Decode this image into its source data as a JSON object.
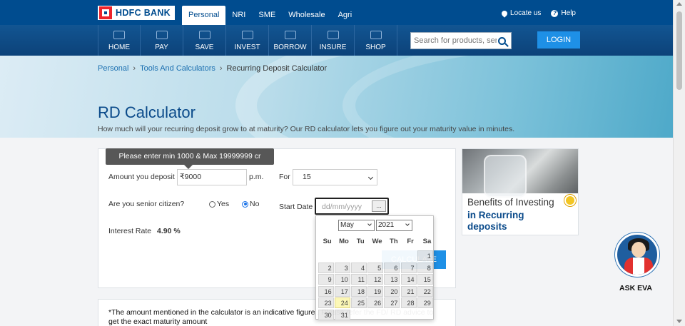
{
  "header": {
    "logo_text": "HDFC BANK",
    "segments": [
      "Personal",
      "NRI",
      "SME",
      "Wholesale",
      "Agri"
    ],
    "active_segment": "Personal",
    "locate_us": "Locate us",
    "help": "Help"
  },
  "nav": {
    "items": [
      "HOME",
      "PAY",
      "SAVE",
      "INVEST",
      "BORROW",
      "INSURE",
      "SHOP"
    ],
    "search_placeholder": "Search for products, services",
    "login_label": "LOGIN"
  },
  "breadcrumb": {
    "items": [
      "Personal",
      "Tools And Calculators",
      "Recurring Deposit Calculator"
    ]
  },
  "hero": {
    "title": "RD Calculator",
    "subtitle": "How much will your recurring deposit grow to at maturity? Our RD calculator lets you figure out your maturity value in minutes."
  },
  "calculator": {
    "tooltip": "Please enter min 1000 & Max 19999999 cr",
    "amount_label": "Amount you deposit",
    "amount_value": "₹9000",
    "per_label": "p.m.",
    "for_label": "For",
    "for_value": "15",
    "senior_label": "Are you senior citizen?",
    "yes_label": "Yes",
    "no_label": "No",
    "start_date_label": "Start Date",
    "start_date_placeholder": "dd/mm/yyyy",
    "date_button": "...",
    "rate_label": "Interest Rate",
    "rate_value": "4.90 %",
    "calculate_label": "CALCULATE"
  },
  "datepicker": {
    "month": "May",
    "year": "2021",
    "weekdays": [
      "Su",
      "Mo",
      "Tu",
      "We",
      "Th",
      "Fr",
      "Sa"
    ],
    "weeks": [
      [
        "",
        "",
        "",
        "",
        "",
        "",
        "1"
      ],
      [
        "2",
        "3",
        "4",
        "5",
        "6",
        "7",
        "8"
      ],
      [
        "9",
        "10",
        "11",
        "12",
        "13",
        "14",
        "15"
      ],
      [
        "16",
        "17",
        "18",
        "19",
        "20",
        "21",
        "22"
      ],
      [
        "23",
        "24",
        "25",
        "26",
        "27",
        "28",
        "29"
      ],
      [
        "30",
        "31",
        "",
        "",
        "",
        "",
        ""
      ]
    ],
    "today": "24"
  },
  "promo": {
    "line1": "Benefits of Investing",
    "line2": "in Recurring",
    "line3": "deposits"
  },
  "eva": {
    "label": "ASK EVA"
  },
  "disclaimer": {
    "text": "*The amount mentioned in the calculator is an indicative figure . Please refer the FD/ RD advice to get the exact maturity amount"
  },
  "colors": {
    "brand_blue": "#004c8f",
    "accent_blue": "#1e90e6",
    "brand_red": "#ed232a"
  }
}
